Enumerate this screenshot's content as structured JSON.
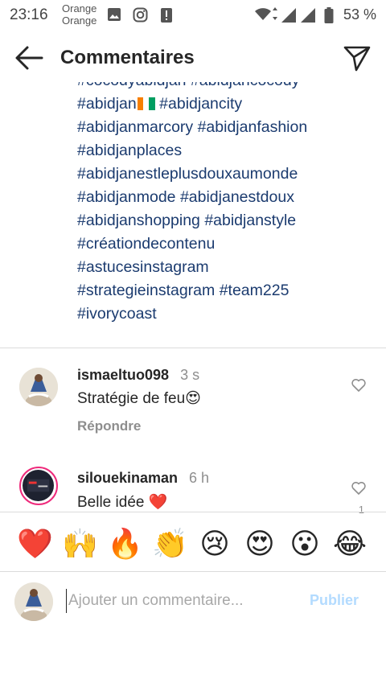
{
  "status_bar": {
    "time": "23:16",
    "carrier_line1": "Orange",
    "carrier_line2": "Orange",
    "battery": "53 %"
  },
  "header": {
    "title": "Commentaires",
    "back_icon": "arrow-left-icon",
    "send_icon": "paper-plane-icon"
  },
  "caption": {
    "hashtags": [
      [
        "#cocodyabidjan",
        "#abidjancocody"
      ],
      [
        "#abidjan",
        "#abidjancity"
      ],
      [
        "#abidjanmarcory",
        "#abidjanfashion"
      ],
      [
        "#abidjanplaces"
      ],
      [
        "#abidjanestleplusdouxaumonde"
      ],
      [
        "#abidjanmode",
        "#abidjanestdoux"
      ],
      [
        "#abidjanshopping",
        "#abidjanstyle"
      ],
      [
        "#créationdecontenu"
      ],
      [
        "#astucesinstagram"
      ],
      [
        "#strategieinstagram",
        "#team225"
      ],
      [
        "#ivorycoast"
      ]
    ],
    "flag_colors": [
      "#f77f00",
      "#ffffff",
      "#009e60"
    ]
  },
  "comments": [
    {
      "username": "ismaeltuo098",
      "time": "3 s",
      "text": "Stratégie de feu😍",
      "reply_label": "Répondre"
    },
    {
      "username": "silouekinaman",
      "time": "6 h",
      "text": "Belle idée ❤️",
      "like_count": "1"
    }
  ],
  "emoji_bar": [
    "❤️",
    "🙌",
    "🔥",
    "👏",
    "😢",
    "😍",
    "😮",
    "😂"
  ],
  "input": {
    "placeholder": "Ajouter un commentaire...",
    "post_label": "Publier"
  },
  "colors": {
    "hashtag": "#1b3b6f",
    "secondary_text": "#8e8e8e",
    "post_disabled": "#b3dbff",
    "story_ring": [
      "#f9ce34",
      "#ee2a7b",
      "#6228d7"
    ]
  }
}
